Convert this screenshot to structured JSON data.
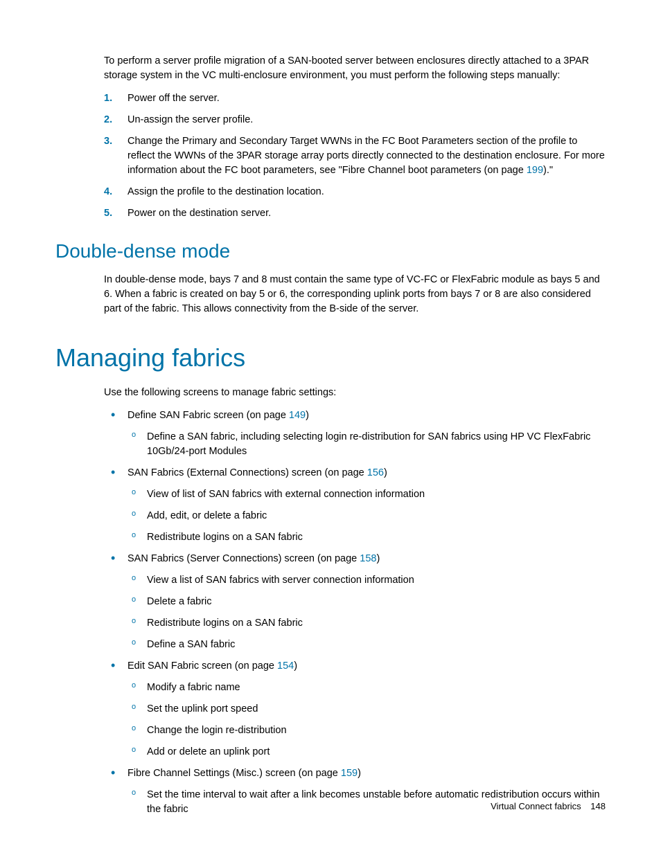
{
  "intro": "To perform a server profile migration of a SAN-booted server between enclosures directly attached to a 3PAR storage system in the VC multi-enclosure environment, you must perform the following steps manually:",
  "steps": {
    "s1": {
      "num": "1.",
      "text": "Power off the server."
    },
    "s2": {
      "num": "2.",
      "text": "Un-assign the server profile."
    },
    "s3": {
      "num": "3.",
      "pre": "Change the Primary and Secondary Target WWNs in the FC Boot Parameters section of the profile to reflect the WWNs of the 3PAR storage array ports directly connected to the destination enclosure. For more information about the FC boot parameters, see \"Fibre Channel boot parameters (on page ",
      "link": "199",
      "post": ").\""
    },
    "s4": {
      "num": "4.",
      "text": "Assign the profile to the destination location."
    },
    "s5": {
      "num": "5.",
      "text": "Power on the destination server."
    }
  },
  "h2": "Double-dense mode",
  "dd_body": "In double-dense mode, bays 7 and 8 must contain the same type of VC-FC or FlexFabric module as bays 5 and 6. When a fabric is created on bay 5 or 6, the corresponding uplink ports from bays 7 or 8 are also considered part of the fabric. This allows connectivity from the B-side of the server.",
  "h1": "Managing fabrics",
  "mf_intro": "Use the following screens to manage fabric settings:",
  "bullets": {
    "b1": {
      "pre": "Define SAN Fabric screen (on page ",
      "link": "149",
      "post": ")",
      "subs": {
        "a": "Define a SAN fabric, including selecting login re-distribution for SAN fabrics using HP VC FlexFabric 10Gb/24-port Modules"
      }
    },
    "b2": {
      "pre": "SAN Fabrics (External Connections) screen (on page ",
      "link": "156",
      "post": ")",
      "subs": {
        "a": "View of list of SAN fabrics with external connection information",
        "b": "Add, edit, or delete a fabric",
        "c": "Redistribute logins on a SAN fabric"
      }
    },
    "b3": {
      "pre": "SAN Fabrics (Server Connections) screen (on page ",
      "link": "158",
      "post": ")",
      "subs": {
        "a": "View a list of SAN fabrics with server connection information",
        "b": "Delete a fabric",
        "c": "Redistribute logins on a SAN fabric",
        "d": "Define a SAN fabric"
      }
    },
    "b4": {
      "pre": "Edit SAN Fabric screen (on page ",
      "link": "154",
      "post": ")",
      "subs": {
        "a": "Modify a fabric name",
        "b": "Set the uplink port speed",
        "c": "Change the login re-distribution",
        "d": "Add or delete an uplink port"
      }
    },
    "b5": {
      "pre": "Fibre Channel Settings (Misc.) screen (on page ",
      "link": "159",
      "post": ")",
      "subs": {
        "a": "Set the time interval to wait after a link becomes unstable before automatic redistribution occurs within the fabric"
      }
    }
  },
  "footer": {
    "section": "Virtual Connect fabrics",
    "page": "148"
  }
}
